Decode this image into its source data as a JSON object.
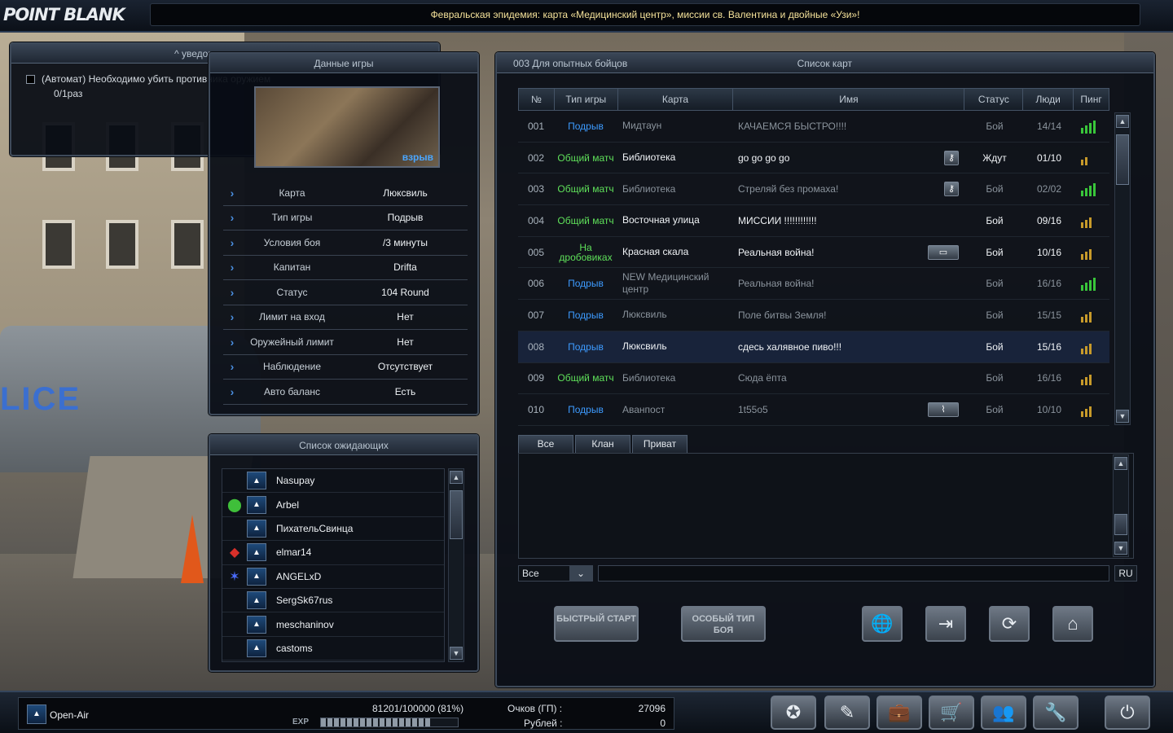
{
  "topbar": {
    "logo": "POINT BLANK",
    "ticker": "Февральская эпидемия: карта «Медицинский центр», миссии св. Валентина и двойные «Узи»!"
  },
  "notice": {
    "title": "^ уведомления задания",
    "text": "(Автомат) Необходимо убить противника оружием",
    "progress": "0/1раз"
  },
  "game_info": {
    "title": "Данные игры",
    "preview_tag": "взрыв",
    "rows": [
      {
        "key": "Карта",
        "value": "Люксвиль"
      },
      {
        "key": "Тип игры",
        "value": "Подрыв"
      },
      {
        "key": "Условия боя",
        "value": "/3 минуты"
      },
      {
        "key": "Капитан",
        "value": "Drifta"
      },
      {
        "key": "Статус",
        "value": "104 Round"
      },
      {
        "key": "Лимит на вход",
        "value": "Нет"
      },
      {
        "key": "Оружейный лимит",
        "value": "Нет"
      },
      {
        "key": "Наблюдение",
        "value": "Отсутствует"
      },
      {
        "key": "Авто баланс",
        "value": "Есть"
      }
    ]
  },
  "waiting": {
    "title": "Список ожидающих",
    "players": [
      {
        "name": "Nasupay",
        "clan_icon": "",
        "rank_icon": "rank-icon"
      },
      {
        "name": "Arbel",
        "clan_icon": "clan-green-icon",
        "rank_icon": "rank-icon"
      },
      {
        "name": "ПихательСвинца",
        "clan_icon": "",
        "rank_icon": "rank-icon"
      },
      {
        "name": "elmar14",
        "clan_icon": "clan-red-icon",
        "rank_icon": "rank-icon"
      },
      {
        "name": "ANGELxD",
        "clan_icon": "clan-star-icon",
        "rank_icon": "rank-icon"
      },
      {
        "name": "SergSk67rus",
        "clan_icon": "",
        "rank_icon": "rank-icon"
      },
      {
        "name": "meschaninov",
        "clan_icon": "",
        "rank_icon": "rank-icon"
      },
      {
        "name": "castoms",
        "clan_icon": "",
        "rank_icon": "rank-icon"
      }
    ]
  },
  "rooms": {
    "server": "003 Для опытных бойцов",
    "title": "Список карт",
    "headers": {
      "no": "№",
      "type": "Тип игры",
      "map": "Карта",
      "name": "Имя",
      "status": "Статус",
      "people": "Люди",
      "ping": "Пинг"
    },
    "rows": [
      {
        "no": "001",
        "type": "Подрыв",
        "type_color": "blue",
        "map": "Мидтаун",
        "name": "КАЧАЕМСЯ БЫСТРО!!!!",
        "status": "Бой",
        "people": "14/14",
        "ping": 4,
        "ping_color": "#39c63a",
        "icon": "",
        "dim": true
      },
      {
        "no": "002",
        "type": "Общий матч",
        "type_color": "green",
        "map": "Библиотека",
        "name": "go go go go",
        "status": "Ждут",
        "people": "01/10",
        "ping": 2,
        "ping_color": "#c79a2a",
        "icon": "key-icon",
        "dim": false
      },
      {
        "no": "003",
        "type": "Общий матч",
        "type_color": "green",
        "map": "Библиотека",
        "name": "Стреляй без промаха!",
        "status": "Бой",
        "people": "02/02",
        "ping": 4,
        "ping_color": "#39c63a",
        "icon": "key-icon",
        "dim": true
      },
      {
        "no": "004",
        "type": "Общий матч",
        "type_color": "green",
        "map": "Восточная улица",
        "name": "МИССИИ  !!!!!!!!!!!!",
        "status": "Бой",
        "people": "09/16",
        "ping": 3,
        "ping_color": "#c79a2a",
        "icon": "",
        "dim": false
      },
      {
        "no": "005",
        "type": "На дробовиках",
        "type_color": "green",
        "map": "Красная скала",
        "name": "Реальная война!",
        "status": "Бой",
        "people": "10/16",
        "ping": 3,
        "ping_color": "#c79a2a",
        "icon": "shotgun-icon",
        "dim": false
      },
      {
        "no": "006",
        "type": "Подрыв",
        "type_color": "blue",
        "map": "NEW Медицинский центр",
        "name": "Реальная война!",
        "status": "Бой",
        "people": "16/16",
        "ping": 4,
        "ping_color": "#39c63a",
        "icon": "",
        "dim": true
      },
      {
        "no": "007",
        "type": "Подрыв",
        "type_color": "blue",
        "map": "Люксвиль",
        "name": "Поле битвы Земля!",
        "status": "Бой",
        "people": "15/15",
        "ping": 3,
        "ping_color": "#c79a2a",
        "icon": "",
        "dim": true
      },
      {
        "no": "008",
        "type": "Подрыв",
        "type_color": "blue",
        "map": "Люксвиль",
        "name": "сдесь халявное пиво!!!",
        "status": "Бой",
        "people": "15/16",
        "ping": 3,
        "ping_color": "#c79a2a",
        "icon": "",
        "dim": false,
        "selected": true
      },
      {
        "no": "009",
        "type": "Общий матч",
        "type_color": "green",
        "map": "Библиотека",
        "name": "Сюда ёпта",
        "status": "Бой",
        "people": "16/16",
        "ping": 3,
        "ping_color": "#c79a2a",
        "icon": "",
        "dim": true
      },
      {
        "no": "010",
        "type": "Подрыв",
        "type_color": "blue",
        "map": "Аванпост",
        "name": "1t55o5",
        "status": "Бой",
        "people": "10/10",
        "ping": 3,
        "ping_color": "#c79a2a",
        "icon": "knife-icon",
        "dim": true
      }
    ]
  },
  "chat": {
    "tabs": [
      "Все",
      "Клан",
      "Приват"
    ],
    "channel": "Все",
    "lang": "RU"
  },
  "actions": {
    "quick_start": "БЫСТРЫЙ СТАРТ",
    "special_mode": "ОСОБЫЙ ТИП БОЯ"
  },
  "user": {
    "nick": "Open-Air",
    "exp": "81201/100000 (81%)",
    "exp_label": "EXP",
    "exp_fraction": 0.81,
    "points_label": "Очков (ГП) :",
    "points": "27096",
    "rubles_label": "Рублей :",
    "rubles": "0"
  }
}
